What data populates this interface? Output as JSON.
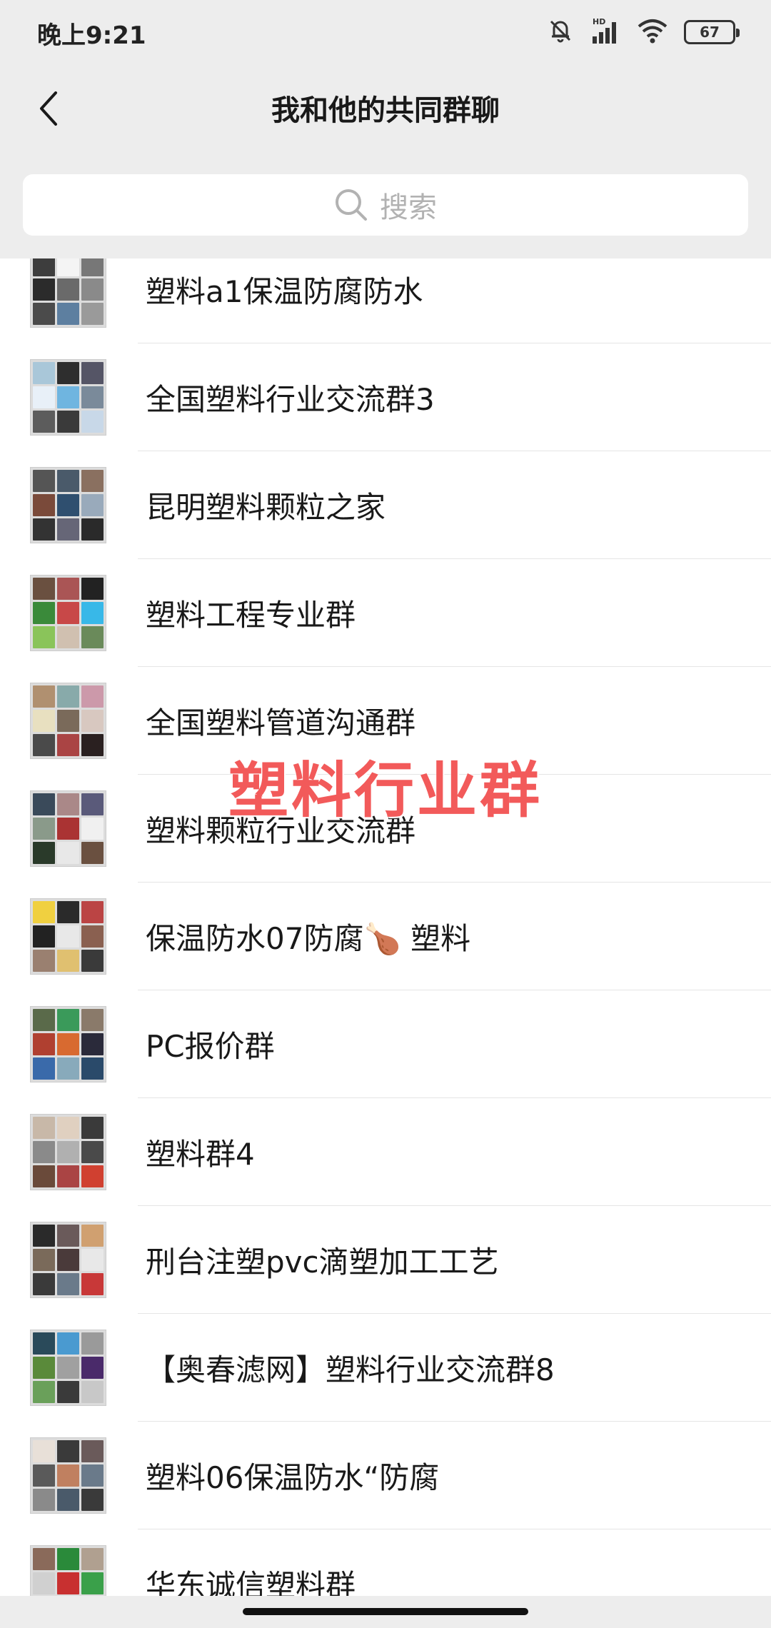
{
  "status_bar": {
    "time": "晚上9:21",
    "battery": "67",
    "icons": [
      "mute-icon",
      "signal-icon",
      "wifi-icon",
      "battery-icon"
    ]
  },
  "nav": {
    "title": "我和他的共同群聊",
    "back_icon": "chevron-left-icon"
  },
  "search": {
    "placeholder": "搜索",
    "icon": "search-icon"
  },
  "groups": [
    {
      "name": "塑料a1保温防腐防水",
      "colors": [
        "#3d3d3d",
        "#f4f4f4",
        "#777",
        "#2b2b2b",
        "#6a6a6a",
        "#8a8a8a",
        "#4b4b4b",
        "#5d7fa0",
        "#9a9a9a"
      ]
    },
    {
      "name": "全国塑料行业交流群3",
      "colors": [
        "#a9c7d9",
        "#2e2e2e",
        "#556",
        "#e8f0f8",
        "#6fb5e0",
        "#7a8a9a",
        "#5c5c5c",
        "#3a3a3a",
        "#c8d8e8"
      ]
    },
    {
      "name": "昆明塑料颗粒之家",
      "colors": [
        "#555",
        "#4a5a6a",
        "#8a7060",
        "#7a4a3a",
        "#2f4f6f",
        "#9ab",
        "#333",
        "#667",
        "#2a2a2a"
      ]
    },
    {
      "name": "塑料工程专业群",
      "colors": [
        "#6a5040",
        "#a55",
        "#222",
        "#3a8a3a",
        "#c84848",
        "#38b8e8",
        "#8ac45a",
        "#d0c0b0",
        "#6a8a5a"
      ]
    },
    {
      "name": "全国塑料管道沟通群",
      "colors": [
        "#b09070",
        "#8aa",
        "#c9a",
        "#e8e0c0",
        "#7a6a5a",
        "#d8c8c0",
        "#4a4a4a",
        "#a44",
        "#2a2020"
      ]
    },
    {
      "name": "塑料颗粒行业交流群",
      "colors": [
        "#3a4a5a",
        "#a88",
        "#5a5a7a",
        "#8a9a8a",
        "#a33",
        "#f0f0f0",
        "#2a3a2a",
        "#e8e8e8",
        "#6a5040"
      ]
    },
    {
      "name": "保温防水07防腐🍗 塑料",
      "colors": [
        "#f0d040",
        "#2a2a2a",
        "#b44",
        "#222",
        "#e8e8e8",
        "#8a6050",
        "#9a8070",
        "#e0c070",
        "#3a3a3a"
      ]
    },
    {
      "name": "PC报价群",
      "colors": [
        "#5a6a4a",
        "#3a9a5a",
        "#8a7a6a",
        "#b04030",
        "#d86a30",
        "#2a2a3a",
        "#3a6aaa",
        "#8ab",
        "#2a4a6a"
      ]
    },
    {
      "name": "塑料群4",
      "colors": [
        "#c8b8a8",
        "#e0d0c0",
        "#3a3a3a",
        "#8a8a8a",
        "#b0b0b0",
        "#4a4a4a",
        "#6a4a3a",
        "#a44",
        "#d04030"
      ]
    },
    {
      "name": "刑台注塑pvc滴塑加工工艺",
      "colors": [
        "#2a2a2a",
        "#6a5a5a",
        "#d0a070",
        "#7a6a5a",
        "#4a3a3a",
        "#e8e8e8",
        "#3a3a3a",
        "#6a7a8a",
        "#c83838"
      ]
    },
    {
      "name": "【奥春滤网】塑料行业交流群8",
      "colors": [
        "#2a4a5a",
        "#4a9ad0",
        "#9a9a9a",
        "#5a8a3a",
        "#a0a0a0",
        "#4a2a6a",
        "#6aa05a",
        "#3a3a3a",
        "#c8c8c8"
      ]
    },
    {
      "name": "塑料06保温防水“防腐",
      "colors": [
        "#e8e0d8",
        "#3a3a3a",
        "#6a5a5a",
        "#5a5a5a",
        "#c08060",
        "#6a7a8a",
        "#8a8a8a",
        "#4a5a6a",
        "#3a3a3a"
      ]
    },
    {
      "name": "华东诚信塑料群",
      "colors": [
        "#8a6a5a",
        "#2a8a3a",
        "#b0a090",
        "#d0d0d0",
        "#c83030",
        "#3aa04a",
        "#a0a0a0",
        "#e0c040",
        "#5a9a5a"
      ]
    }
  ],
  "watermark": "塑料行业群"
}
